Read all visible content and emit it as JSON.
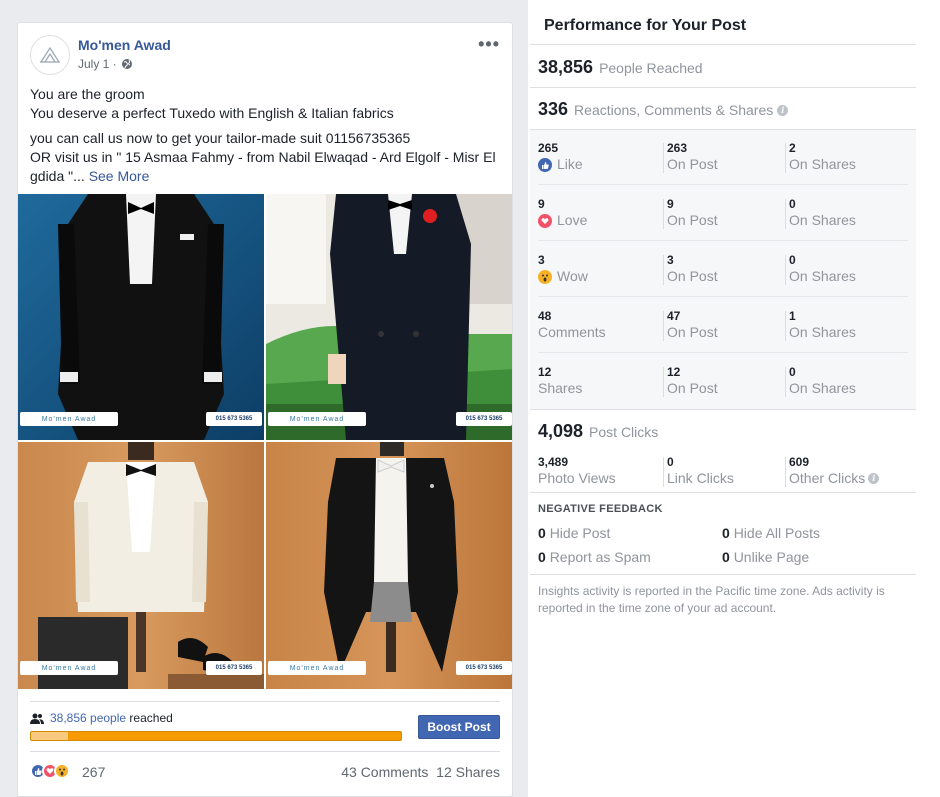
{
  "post": {
    "author": "Mo'men Awad",
    "date": "July 1 ·",
    "text_line1": "You are the groom",
    "text_line2": "You deserve a perfect Tuxedo with English & Italian fabrics",
    "text_line3": "you can call us now to get your tailor-made suit 01156735365",
    "text_line4": "OR visit us in \" 15 Asmaa Fahmy - from Nabil Elwaqad - Ard Elgolf - Misr El gdida \"...",
    "see_more": "See More",
    "watermark": "Mo'men Awad",
    "phone_badge": "015 673 5365",
    "reached_count": "38,856 people",
    "reached_suffix": "reached",
    "reach_organic_fraction": 0.1,
    "boost_label": "Boost Post",
    "reaction_total": "267",
    "comments": "43 Comments",
    "shares": "12 Shares"
  },
  "panel": {
    "title": "Performance for Your Post",
    "people_reached_num": "38,856",
    "people_reached_label": "People Reached",
    "engagement_num": "336",
    "engagement_label": "Reactions, Comments & Shares",
    "rows": [
      {
        "num": "265",
        "label": "Like",
        "icon": "like-icon",
        "on_post_num": "263",
        "on_shares_num": "2"
      },
      {
        "num": "9",
        "label": "Love",
        "icon": "love-icon",
        "on_post_num": "9",
        "on_shares_num": "0"
      },
      {
        "num": "3",
        "label": "Wow",
        "icon": "wow-icon",
        "on_post_num": "3",
        "on_shares_num": "0"
      },
      {
        "num": "48",
        "label": "Comments",
        "icon": "",
        "on_post_num": "47",
        "on_shares_num": "1"
      },
      {
        "num": "12",
        "label": "Shares",
        "icon": "",
        "on_post_num": "12",
        "on_shares_num": "0"
      }
    ],
    "on_post_label": "On Post",
    "on_shares_label": "On Shares",
    "post_clicks_num": "4,098",
    "post_clicks_label": "Post Clicks",
    "photo_views_num": "3,489",
    "photo_views_label": "Photo Views",
    "link_clicks_num": "0",
    "link_clicks_label": "Link Clicks",
    "other_clicks_num": "609",
    "other_clicks_label": "Other Clicks",
    "negative_title": "NEGATIVE FEEDBACK",
    "hide_post_num": "0",
    "hide_post_label": "Hide Post",
    "hide_all_num": "0",
    "hide_all_label": "Hide All Posts",
    "spam_num": "0",
    "spam_label": "Report as Spam",
    "unlike_num": "0",
    "unlike_label": "Unlike Page",
    "footnote": "Insights activity is reported in the Pacific time zone. Ads activity is reported in the time zone of your ad account."
  },
  "colors": {
    "like_blue": "#4267b2",
    "love_red": "#f25268",
    "wow_yellow": "#f7b125",
    "progress_orange": "#f59b00"
  }
}
